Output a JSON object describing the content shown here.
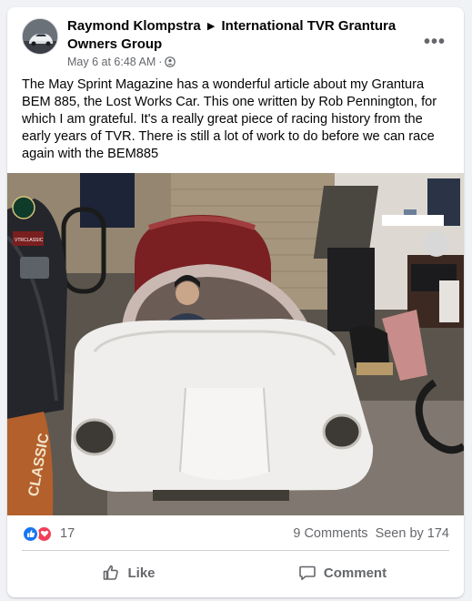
{
  "post": {
    "author": "Raymond Klompstra",
    "group": "International TVR Grantura Owners Group",
    "timestamp": "May 6 at 6:48 AM",
    "separator": "·",
    "privacy_icon": "friends-icon",
    "text": "The May Sprint Magazine has a wonderful article about my Grantura BEM 885, the Lost Works Car. This one written by Rob Pennington, for which I am grateful. It's a really great piece of racing history from the early years of TVR. There is still a lot of work to do before we can race again with the BEM885"
  },
  "photo_overlay": {
    "jacket_patch": "VTRCLASSIC",
    "sign": "CLASSIC"
  },
  "stats": {
    "reaction_count": "17",
    "comments": "9 Comments",
    "seen": "Seen by 174"
  },
  "actions": {
    "like": "Like",
    "comment": "Comment"
  },
  "colors": {
    "accent": "#1877f2",
    "love": "#f33e58",
    "secondary_text": "#65676b"
  }
}
